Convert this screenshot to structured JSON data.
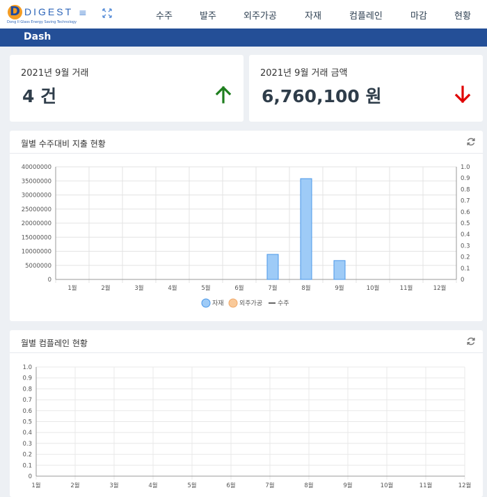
{
  "brand": {
    "logo_text": "DIGEST",
    "tagline": "Dong Il Glass Energy Saving Technology",
    "logo_letter": "D"
  },
  "nav": [
    "수주",
    "발주",
    "외주가공",
    "자재",
    "컴플레인",
    "마감",
    "현황"
  ],
  "page_title": "Dash",
  "stats": {
    "count_label": "2021년 9월 거래",
    "count_value": "4 건",
    "amount_label": "2021년 9월 거래 금액",
    "amount_value": "6,760,100 원"
  },
  "colors": {
    "up": "#1e7e1e",
    "down": "#e00000",
    "bar_fill": "#9ecbf7",
    "bar_stroke": "#4a97e8",
    "legend_orange": "#f9c999",
    "bluebar": "#244f97"
  },
  "panel1": {
    "title": "월별 수주대비 지출 현황"
  },
  "panel2": {
    "title": "월별 컴플레인 현황"
  },
  "chart_data": [
    {
      "type": "bar",
      "categories": [
        "1월",
        "2월",
        "3월",
        "4월",
        "5월",
        "6월",
        "7월",
        "8월",
        "9월",
        "10월",
        "11월",
        "12월"
      ],
      "series": [
        {
          "name": "자재",
          "values": [
            0,
            0,
            0,
            0,
            0,
            0,
            8900000,
            35800000,
            6700000,
            0,
            0,
            0
          ]
        },
        {
          "name": "외주가공",
          "values": [
            0,
            0,
            0,
            0,
            0,
            0,
            0,
            0,
            0,
            0,
            0,
            0
          ]
        },
        {
          "name": "수주",
          "values": [
            0,
            0,
            0,
            0,
            0,
            0,
            0,
            0,
            0,
            0,
            0,
            0
          ]
        }
      ],
      "y_ticks": [
        "40000000",
        "35000000",
        "30000000",
        "25000000",
        "20000000",
        "15000000",
        "10000000",
        "5000000",
        "0"
      ],
      "y2_ticks": [
        "1.0",
        "0.9",
        "0.8",
        "0.7",
        "0.6",
        "0.5",
        "0.4",
        "0.3",
        "0.2",
        "0.1",
        "0"
      ],
      "ylim": [
        0,
        40000000
      ],
      "legend": "bottom",
      "grid": true
    },
    {
      "type": "line",
      "categories": [
        "1월",
        "2월",
        "3월",
        "4월",
        "5월",
        "6월",
        "7월",
        "8월",
        "9월",
        "10월",
        "11월",
        "12월"
      ],
      "series": [],
      "y_ticks": [
        "1.0",
        "0.9",
        "0.8",
        "0.7",
        "0.6",
        "0.5",
        "0.4",
        "0.3",
        "0.2",
        "0.1",
        "0"
      ],
      "ylim": [
        0,
        1
      ],
      "grid": true
    }
  ]
}
